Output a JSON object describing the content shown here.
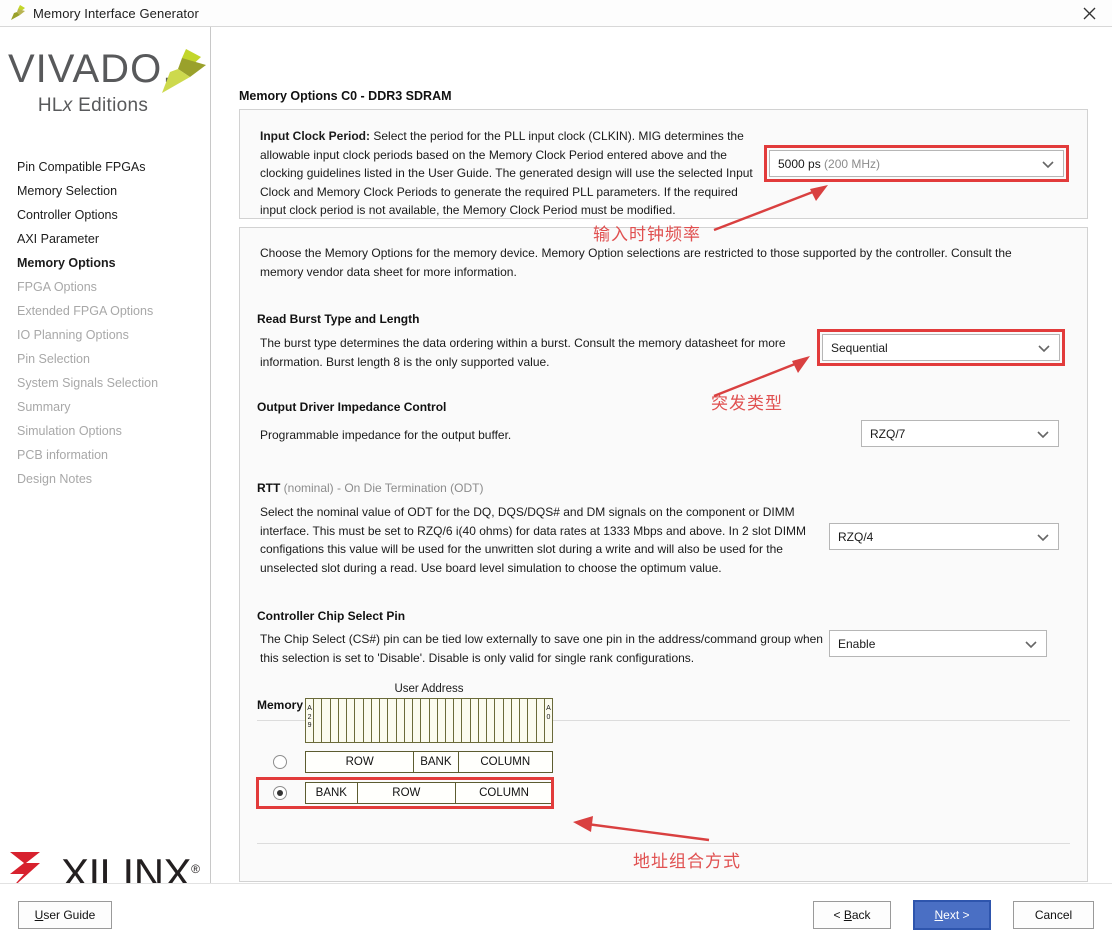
{
  "window": {
    "title": "Memory Interface Generator",
    "app_icon": "vivado-pinwheel-icon",
    "close_icon": "close-icon"
  },
  "sidebar": {
    "logo": {
      "word": "VIVADO",
      "sub_prefix": "HL",
      "sub_italic": "x",
      "sub_suffix": " Editions"
    },
    "footer_logo": {
      "word": "XILINX",
      "reg": "®"
    },
    "items": [
      {
        "label": "Pin Compatible FPGAs",
        "state": "enabled"
      },
      {
        "label": "Memory Selection",
        "state": "enabled"
      },
      {
        "label": "Controller Options",
        "state": "enabled"
      },
      {
        "label": "AXI Parameter",
        "state": "enabled"
      },
      {
        "label": "Memory Options",
        "state": "active"
      },
      {
        "label": "FPGA Options",
        "state": "disabled"
      },
      {
        "label": "Extended FPGA Options",
        "state": "disabled"
      },
      {
        "label": "IO Planning Options",
        "state": "disabled"
      },
      {
        "label": "Pin Selection",
        "state": "disabled"
      },
      {
        "label": "System Signals Selection",
        "state": "disabled"
      },
      {
        "label": "Summary",
        "state": "disabled"
      },
      {
        "label": "Simulation Options",
        "state": "disabled"
      },
      {
        "label": "PCB information",
        "state": "disabled"
      },
      {
        "label": "Design Notes",
        "state": "disabled"
      }
    ]
  },
  "main": {
    "page_title": "Memory Options C0 - DDR3 SDRAM",
    "clock_group": {
      "label_bold": "Input Clock Period:",
      "description": " Select the period for the PLL input clock (CLKIN). MIG determines the allowable input clock periods based on the Memory Clock Period entered above and the clocking guidelines listed in the User Guide. The generated design will use the selected Input Clock and Memory Clock Periods to generate the required PLL parameters. If the required input clock period is not available, the Memory Clock Period must be modified.",
      "combo_value": "5000 ps",
      "combo_value_muted": "(200 MHz)"
    },
    "intro": "Choose the Memory Options for the memory device. Memory Option selections are restricted to those supported by the controller. Consult the memory vendor data sheet for more information.",
    "sections": [
      {
        "heading": "Read Burst Type and Length",
        "body": "The burst type determines the data ordering within a burst. Consult the memory datasheet for more information. Burst length 8 is the only supported value.",
        "combo_value": "Sequential"
      },
      {
        "heading": "Output Driver Impedance Control",
        "body": "Programmable impedance for the output buffer.",
        "combo_value": "RZQ/7"
      },
      {
        "heading_bold": "RTT",
        "heading_muted": " (nominal) - On Die Termination (ODT)",
        "body": "Select the nominal value of ODT for the DQ, DQS/DQS# and DM signals on the component or DIMM interface. This must be set to RZQ/6 i(40 ohms) for data rates at 1333 Mbps and above. In 2 slot DIMM configations this value will be used for the unwritten slot during a write and will also be used for the unselected slot during a read. Use board level simulation to choose the optimum value.",
        "combo_value": "RZQ/4"
      },
      {
        "heading": "Controller Chip Select Pin",
        "body": "The Chip Select (CS#) pin can be tied low externally to save one pin in the address/command group when this selection is set to 'Disable'. Disable is only valid for single rank configurations.",
        "combo_value": "Enable"
      }
    ],
    "address_mapping": {
      "heading": "Memory Address Mapping Selection",
      "user_address_label": "User Address",
      "bit_high_label": "A29",
      "bit_low_label": "A0",
      "bit_cell_count": 30,
      "options": [
        {
          "selected": false,
          "segments": [
            "ROW",
            "BANK",
            "COLUMN"
          ],
          "widths": [
            44,
            18,
            38
          ]
        },
        {
          "selected": true,
          "segments": [
            "BANK",
            "ROW",
            "COLUMN"
          ],
          "widths": [
            21,
            40,
            39
          ]
        }
      ]
    },
    "annotations": [
      {
        "text": "输入时钟频率",
        "name": "annotation-input-clock-frequency"
      },
      {
        "text": "突发类型",
        "name": "annotation-burst-type"
      },
      {
        "text": "地址组合方式",
        "name": "annotation-address-mapping"
      }
    ]
  },
  "footer": {
    "user_guide": {
      "pre": "",
      "accel": "U",
      "post": "ser Guide"
    },
    "back": {
      "pre": "< ",
      "accel": "B",
      "post": "ack"
    },
    "next": {
      "pre": "",
      "accel": "N",
      "post": "ext >"
    },
    "cancel": {
      "label": "Cancel"
    }
  },
  "colors": {
    "accent_blue": "#4a6fc4",
    "highlight_red": "#e23b3b",
    "annotation_red": "#e05050",
    "xilinx_red": "#d7212e",
    "vivado_green": "#c3d62a"
  }
}
